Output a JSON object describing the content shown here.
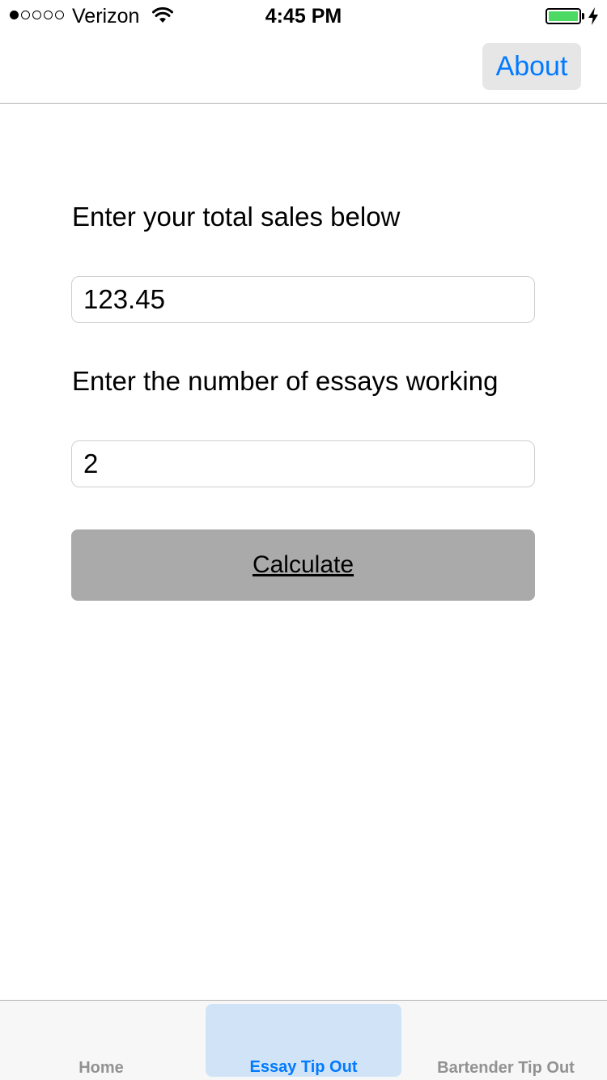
{
  "status_bar": {
    "signal_dots_filled": 1,
    "signal_dots_total": 5,
    "carrier": "Verizon",
    "time": "4:45 PM",
    "battery_color": "#4cd964",
    "icons": [
      "wifi-icon",
      "battery-icon",
      "charging-bolt-icon"
    ]
  },
  "nav": {
    "about_label": "About",
    "accent_color": "#007aff"
  },
  "form": {
    "sales_label": "Enter your total sales below",
    "sales_value": "123.45",
    "essays_label": "Enter the number of essays working",
    "essays_value": "2",
    "calculate_label": "Calculate"
  },
  "tabs": [
    {
      "label": "Home",
      "selected": false
    },
    {
      "label": "Essay Tip Out",
      "selected": true
    },
    {
      "label": "Bartender Tip Out",
      "selected": false
    }
  ]
}
